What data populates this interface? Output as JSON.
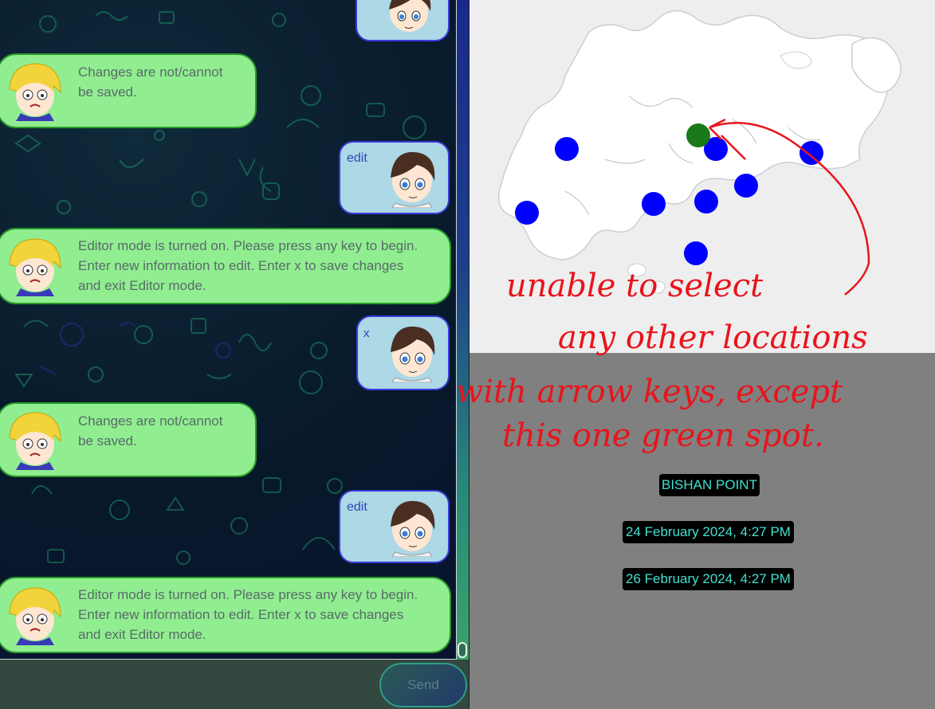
{
  "chat": {
    "messages": [
      {
        "sender": "bot",
        "lines": [
          "Changes are not/cannot",
          "be saved."
        ]
      },
      {
        "sender": "user",
        "text": "edit"
      },
      {
        "sender": "bot",
        "lines": [
          "Editor mode is turned on. Please press any key to begin.",
          "Enter new information to edit. Enter x to save changes",
          "and exit Editor mode."
        ]
      },
      {
        "sender": "user",
        "text": "x"
      },
      {
        "sender": "bot",
        "lines": [
          "Changes are not/cannot",
          "be saved."
        ]
      },
      {
        "sender": "user",
        "text": "edit"
      },
      {
        "sender": "bot",
        "lines": [
          "Editor mode is turned on. Please press any key to begin.",
          "Enter new information to edit. Enter x to save changes",
          "and exit Editor mode."
        ]
      }
    ],
    "send_label": "Send"
  },
  "details": {
    "location_name": "BISHAN POINT",
    "start_datetime": "24 February 2024, 4:27 PM",
    "end_datetime": "26 February 2024, 4:27 PM"
  },
  "annotation": {
    "lines": [
      "unable to select",
      "any other locations",
      "with arrow keys, except",
      "this one green spot."
    ]
  },
  "colors": {
    "location_marker": "#0000ff",
    "selected_marker": "#1a7a1a",
    "bot_bubble": "#90ee90",
    "user_bubble": "#add8e6",
    "annotation_ink": "#e8141c",
    "chip_text": "#40e0d0"
  }
}
